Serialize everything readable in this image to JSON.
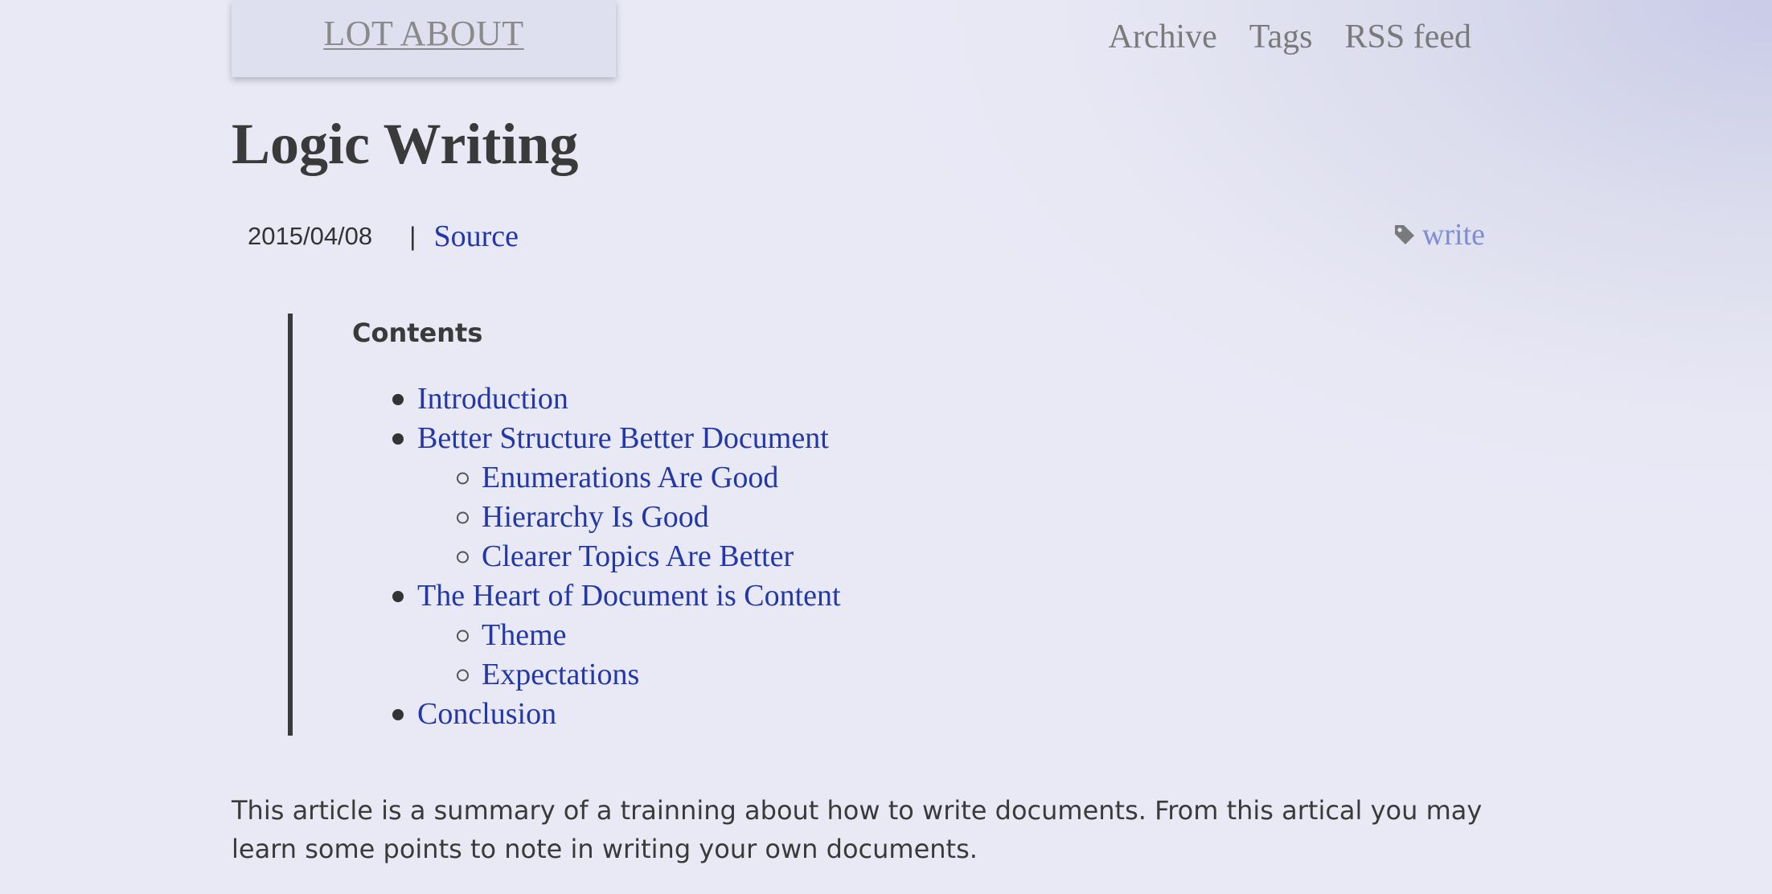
{
  "site": {
    "title": "LOT ABOUT",
    "nav": [
      {
        "label": "Archive"
      },
      {
        "label": "Tags"
      },
      {
        "label": "RSS feed"
      }
    ]
  },
  "post": {
    "title": "Logic Writing",
    "date": "2015/04/08",
    "separator": "|",
    "source_label": "Source",
    "tag_icon": "tag-icon",
    "tag": "write"
  },
  "toc": {
    "title": "Contents",
    "items": [
      {
        "label": "Introduction",
        "level": 1
      },
      {
        "label": "Better Structure Better Document",
        "level": 1
      },
      {
        "label": "Enumerations Are Good",
        "level": 2
      },
      {
        "label": "Hierarchy Is Good",
        "level": 2
      },
      {
        "label": "Clearer Topics Are Better",
        "level": 2
      },
      {
        "label": "The Heart of Document is Content",
        "level": 1
      },
      {
        "label": "Theme",
        "level": 2
      },
      {
        "label": "Expectations",
        "level": 2
      },
      {
        "label": "Conclusion",
        "level": 1
      }
    ]
  },
  "body": {
    "intro": "This article is a summary of a trainning about how to write documents. From this artical you may learn some points to note in writing your own documents."
  },
  "colors": {
    "link": "#2338a8",
    "tag_link": "#7f8cd4",
    "nav_text": "#7a7a7a",
    "text": "#3a3a3a"
  }
}
